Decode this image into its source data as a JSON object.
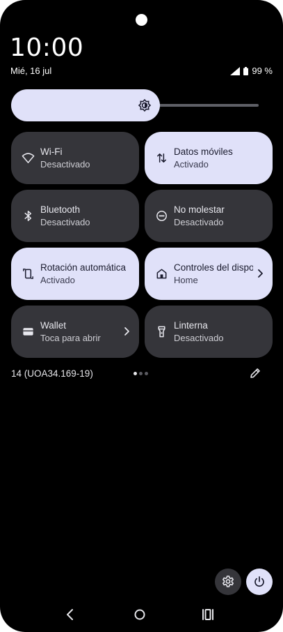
{
  "status_bar": {
    "time": "10:00",
    "date": "Mié, 16 jul",
    "battery": "99 %",
    "signal_icon": "cell-signal-icon",
    "battery_icon": "battery-icon"
  },
  "brightness": {
    "level": 0.6,
    "icon": "brightness-icon"
  },
  "tiles": [
    {
      "title": "Wi-Fi",
      "subtitle": "Desactivado",
      "state": "off",
      "icon": "wifi-icon"
    },
    {
      "title": "Datos móviles",
      "subtitle": "Activado",
      "state": "on",
      "icon": "mobile-data-icon"
    },
    {
      "title": "Bluetooth",
      "subtitle": "Desactivado",
      "state": "off",
      "icon": "bluetooth-icon"
    },
    {
      "title": "No molestar",
      "subtitle": "Desactivado",
      "state": "off",
      "icon": "do-not-disturb-icon"
    },
    {
      "title": "Rotación automática",
      "subtitle": "Activado",
      "state": "on",
      "icon": "auto-rotate-icon"
    },
    {
      "title": "Controles del dispositivo",
      "subtitle": "Home",
      "state": "on",
      "icon": "home-icon"
    },
    {
      "title": "Wallet",
      "subtitle": "Toca para abrir",
      "state": "off",
      "icon": "wallet-icon"
    },
    {
      "title": "Linterna",
      "subtitle": "Desactivado",
      "state": "off",
      "icon": "flashlight-icon"
    }
  ],
  "footer": {
    "build": "14 (UOA34.169-19)",
    "page_count": 3,
    "current_page": 1,
    "edit_icon": "edit-pencil-icon"
  },
  "actions": {
    "settings_icon": "gear-icon",
    "power_icon": "power-icon"
  },
  "nav": {
    "back_icon": "back-chevron-icon",
    "home_icon": "home-circle-icon",
    "recents_icon": "recents-icon"
  },
  "colors": {
    "background": "#000000",
    "tile_on": "#e0e1f9",
    "tile_off": "#35353a"
  }
}
